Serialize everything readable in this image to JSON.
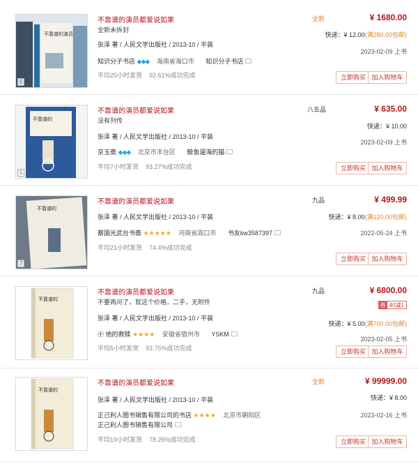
{
  "listings": [
    {
      "title": "不靠谱的演员都爱说如果",
      "subtitle": "全新未拆封",
      "author_line": "张泽 著 / 人民文学出版社 / 2013-10 / 平装",
      "shop_name": "知识分子书店",
      "rating_icon": "diamond-icon",
      "rating_glyphs": "💎💎💎",
      "location": "海南省海口市",
      "seller": "知识分子书店",
      "ship_time": "平均25小时发货",
      "success_rate": "92.61%成功完成",
      "condition": "全新",
      "price": "¥ 1680.00",
      "shipping": "快递：¥ 12.00",
      "free_shipping": "(满280.00包邮)",
      "date": "2023-02-09 上书",
      "thumb_count": "5",
      "buy_label": "立即购买",
      "cart_label": "加入购物车"
    },
    {
      "title": "不靠谱的演员都爱说如果",
      "subtitle": "没有列传",
      "author_line": "张泽 著 / 人民文学出版社 / 2013-10 / 平装",
      "shop_name": "京玉斋",
      "rating_icon": "diamond-icon",
      "rating_glyphs": "💎💎💎",
      "location": "北京市丰台区",
      "seller": "鲸鱼遛海的猫",
      "ship_time": "平均7小时发货",
      "success_rate": "93.27%成功完成",
      "condition": "八五品",
      "price": "¥ 635.00",
      "shipping": "快递：¥ 10.00",
      "free_shipping": "",
      "date": "2023-02-09 上书",
      "thumb_count": "5",
      "buy_label": "立即购买",
      "cart_label": "加入购物车"
    },
    {
      "title": "不靠谱的演员都爱说如果",
      "subtitle": "",
      "author_line": "张泽 著 / 人民文学出版社 / 2013-10 / 平装",
      "shop_name": "蔡国光武台书斋",
      "rating_icon": "star-icon",
      "rating_glyphs": "★★★★★",
      "location": "河南省周口市",
      "seller": "书友kw3587397",
      "ship_time": "平均21小时发货",
      "success_rate": "74.4%成功完成",
      "condition": "九品",
      "price": "¥ 499.99",
      "shipping": "快递：¥ 8.00",
      "free_shipping": "(满120.00包邮)",
      "date": "2022-05-24 上书",
      "thumb_count": "7",
      "buy_label": "立即购买",
      "cart_label": "加入购物车"
    },
    {
      "title": "不靠谱的演员都爱说如果",
      "subtitle": "不要再问了，就这个价格，二手，无附件",
      "author_line": "张泽 著 / 人民文学出版社 / 2013-10 / 平装",
      "shop_name": "他的救赎",
      "shop_prefix": "㊉",
      "rating_icon": "star-icon",
      "rating_glyphs": "★★★★",
      "location": "安徽省宿州市",
      "seller": "YSKM",
      "ship_time": "平均5小时发货",
      "success_rate": "93.75%成功完成",
      "condition": "九品",
      "price": "¥ 6800.00",
      "coupon_key": "券",
      "coupon_value": "40减1",
      "shipping": "快递：¥ 5.00",
      "free_shipping": "(满700.00包邮)",
      "date": "2023-02-05 上书",
      "thumb_count": "",
      "buy_label": "立即购买",
      "cart_label": "加入购物车"
    },
    {
      "title": "不靠谱的演员都爱说如果",
      "subtitle": "",
      "author_line": "张泽 著 / 人民文学出版社 / 2013-10 / 平装",
      "shop_name": "正己利人图书销售有限公司的书店",
      "rating_icon": "star-icon",
      "rating_glyphs": "★★★★",
      "location": "北京市朝阳区",
      "seller": "正己利人图书销售有限公司",
      "ship_time": "平均19小时发货",
      "success_rate": "78.26%成功完成",
      "condition": "全新",
      "price": "¥ 99999.00",
      "shipping": "快递：¥ 8.00",
      "free_shipping": "",
      "date": "2023-02-16 上书",
      "thumb_count": "",
      "buy_label": "立即购买",
      "cart_label": "加入购物车"
    }
  ]
}
